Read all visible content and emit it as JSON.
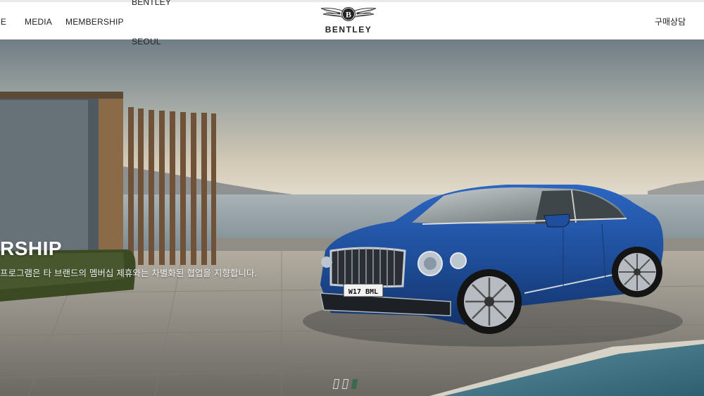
{
  "header": {
    "nav": [
      {
        "label": "CE"
      },
      {
        "label": "MEDIA"
      },
      {
        "label": "MEMBERSHIP"
      },
      {
        "label": "BENTLEY SEOUL"
      }
    ],
    "logo_text": "BENTLEY",
    "cta_label": "구매상담"
  },
  "hero": {
    "headline": "RSHIP",
    "subtext": "프로그램은 타 브랜드의 멤버십 제휴와는 차별화된 협업을 지향합니다.",
    "plate": "W17 BML",
    "slides": [
      {
        "state": "inactive"
      },
      {
        "state": "inactive"
      },
      {
        "state": "active"
      }
    ]
  },
  "colors": {
    "car_blue": "#1f4f9c",
    "slider_active": "#3b6b4a",
    "header_bg": "#ffffff"
  }
}
